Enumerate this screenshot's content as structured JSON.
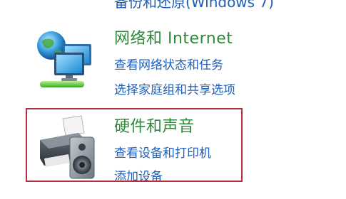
{
  "cropped_top_link": "备份和还原(Windows 7)",
  "categories": [
    {
      "title": "网络和 Internet",
      "links": [
        "查看网络状态和任务",
        "选择家庭组和共享选项"
      ],
      "icon": "network-icon"
    },
    {
      "title": "硬件和声音",
      "links": [
        "查看设备和打印机",
        "添加设备"
      ],
      "icon": "printer-icon"
    }
  ],
  "colors": {
    "category_title": "#2d8a3a",
    "link": "#1f5fb8",
    "highlight_border": "#b0303f"
  }
}
